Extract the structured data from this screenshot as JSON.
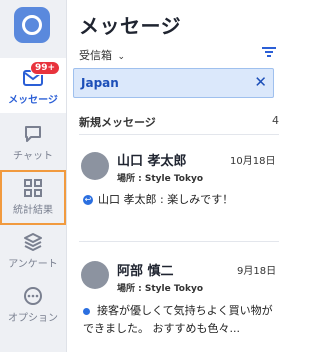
{
  "sidebar": {
    "badge": "99+",
    "items": [
      {
        "label": "メッセージ",
        "icon": "mail-icon"
      },
      {
        "label": "チャット",
        "icon": "chat-icon"
      },
      {
        "label": "統計結果",
        "icon": "grid-icon"
      },
      {
        "label": "アンケート",
        "icon": "layers-icon"
      },
      {
        "label": "オプション",
        "icon": "more-icon"
      }
    ]
  },
  "header": {
    "title": "メッセージ",
    "folder": "受信箱",
    "folder_chevron": "⌄"
  },
  "search": {
    "value": "Japan",
    "clear": "✕"
  },
  "section": {
    "title": "新規メッセージ",
    "count": "4"
  },
  "messages": [
    {
      "name": "山口 孝太郎",
      "date": "10月18日",
      "place": "場所 : Style Tokyo",
      "preview": "山口 孝太郎 : 楽しみです！",
      "status": "replied"
    },
    {
      "name": "阿部 慎二",
      "date": "9月18日",
      "place": "場所 : Style Tokyo",
      "preview": "接客が優しくて気持ちよく買い物ができました。 おすすめも色々...",
      "status": "unread"
    }
  ],
  "colors": {
    "accent": "#2b5fd6",
    "badge": "#e8333d",
    "outline": "#f19a3e"
  }
}
